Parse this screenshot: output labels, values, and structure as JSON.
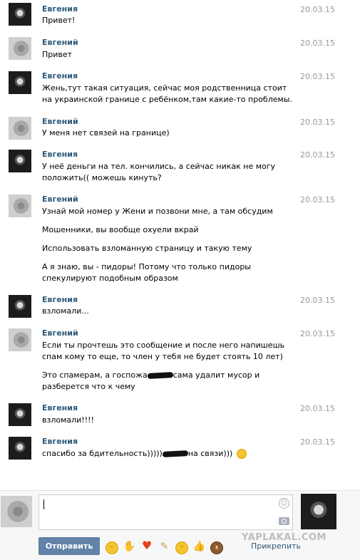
{
  "messages": [
    {
      "sender": "Евгения",
      "date": "20.03.15",
      "lines": [
        "Привет!"
      ]
    },
    {
      "sender": "Евгений",
      "date": "20.03.15",
      "lines": [
        "Привет"
      ]
    },
    {
      "sender": "Евгения",
      "date": "20.03.15",
      "lines": [
        "Жень,тут такая ситуация, сейчас моя родственница стоит на украинской границе с ребёнком,там какие-то проблемы."
      ]
    },
    {
      "sender": "Евгений",
      "date": "20.03.15",
      "lines": [
        "У меня нет связей на границе)"
      ]
    },
    {
      "sender": "Евгения",
      "date": "20.03.15",
      "lines": [
        "У неё деньги на тел. кончились, а сейчас никак не могу положить(( можешь кинуть?"
      ]
    },
    {
      "sender": "Евгений",
      "date": "20.03.15",
      "lines": [
        "Узнай мой номер у Жени и позвони мне, а там обсудим",
        "Мошенники, вы вообще охуели вкрай",
        "Использовать взломанную страницу и такую тему",
        "А я знаю, вы - пидоры! Потому что только пидоры спекулируют подобным образом"
      ]
    },
    {
      "sender": "Евгения",
      "date": "20.03.15",
      "lines": [
        "взломали..."
      ]
    },
    {
      "sender": "Евгений",
      "date": "20.03.15",
      "lines": [
        "Если ты прочтешь это сообщение и после него напишешь спам кому то еще, то член у тебя не будет стоять 10 лет)",
        "Это спамерам, а госпожа",
        "сама удалит мусор и разберется что к чему"
      ]
    },
    {
      "sender": "Евгения",
      "date": "20.03.15",
      "lines": [
        "взломали!!!!"
      ]
    },
    {
      "sender": "Евгения",
      "date": "20.03.15",
      "lines": [
        "спасибо за бдительность)))))",
        "на связи)))"
      ]
    }
  ],
  "composer": {
    "send_label": "Отправить",
    "attach_label": "Прикрепить",
    "watermark": "YAPLAKAL.COM"
  },
  "icons": {
    "emoji_bar": [
      "smile-icon",
      "hand-icon",
      "heart-icon",
      "pencil-icon",
      "wink-icon",
      "thumbs-up-icon",
      "bear-icon"
    ]
  }
}
